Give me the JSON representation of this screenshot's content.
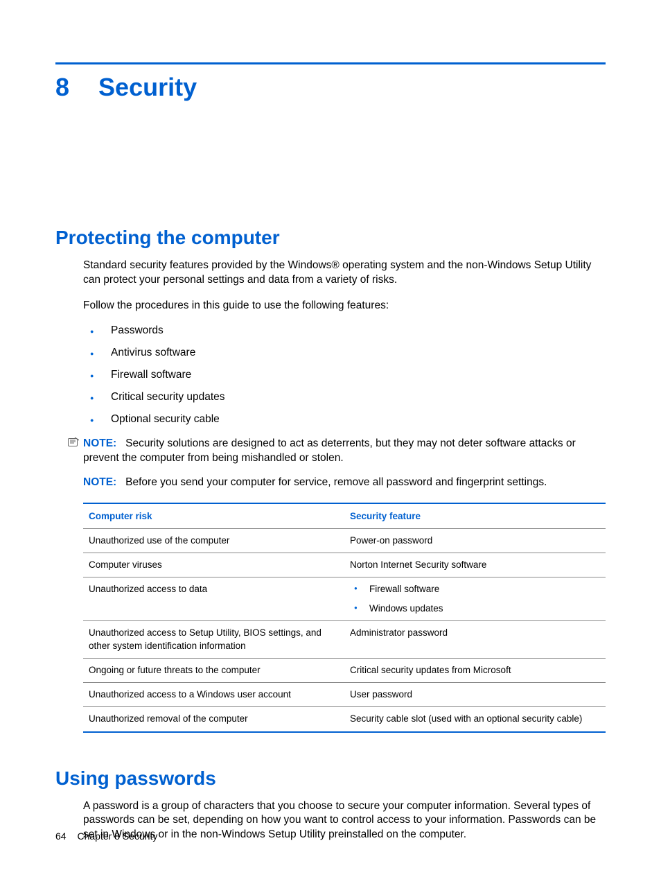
{
  "chapter": {
    "number": "8",
    "title": "Security"
  },
  "section1": {
    "title": "Protecting the computer",
    "p1": "Standard security features provided by the Windows® operating system and the non-Windows Setup Utility can protect your personal settings and data from a variety of risks.",
    "p2": "Follow the procedures in this guide to use the following features:",
    "bullets": [
      "Passwords",
      "Antivirus software",
      "Firewall software",
      "Critical security updates",
      "Optional security cable"
    ],
    "note1": {
      "label": "NOTE:",
      "text": "Security solutions are designed to act as deterrents, but they may not deter software attacks or prevent the computer from being mishandled or stolen."
    },
    "note2": {
      "label": "NOTE:",
      "text": "Before you send your computer for service, remove all password and fingerprint settings."
    },
    "table": {
      "head": {
        "col1": "Computer risk",
        "col2": "Security feature"
      },
      "rows": [
        {
          "risk": "Unauthorized use of the computer",
          "feature": "Power-on password"
        },
        {
          "risk": "Computer viruses",
          "feature": "Norton Internet Security software"
        },
        {
          "risk": "Unauthorized access to data",
          "feature_list": [
            "Firewall software",
            "Windows updates"
          ]
        },
        {
          "risk": "Unauthorized access to Setup Utility, BIOS settings, and other system identification information",
          "feature": "Administrator password"
        },
        {
          "risk": "Ongoing or future threats to the computer",
          "feature": "Critical security updates from Microsoft"
        },
        {
          "risk": "Unauthorized access to a Windows user account",
          "feature": "User password"
        },
        {
          "risk": "Unauthorized removal of the computer",
          "feature": "Security cable slot (used with an optional security cable)"
        }
      ]
    }
  },
  "section2": {
    "title": "Using passwords",
    "p1": "A password is a group of characters that you choose to secure your computer information. Several types of passwords can be set, depending on how you want to control access to your information. Passwords can be set in Windows or in the non-Windows Setup Utility preinstalled on the computer."
  },
  "footer": {
    "page": "64",
    "text": "Chapter 8   Security"
  }
}
